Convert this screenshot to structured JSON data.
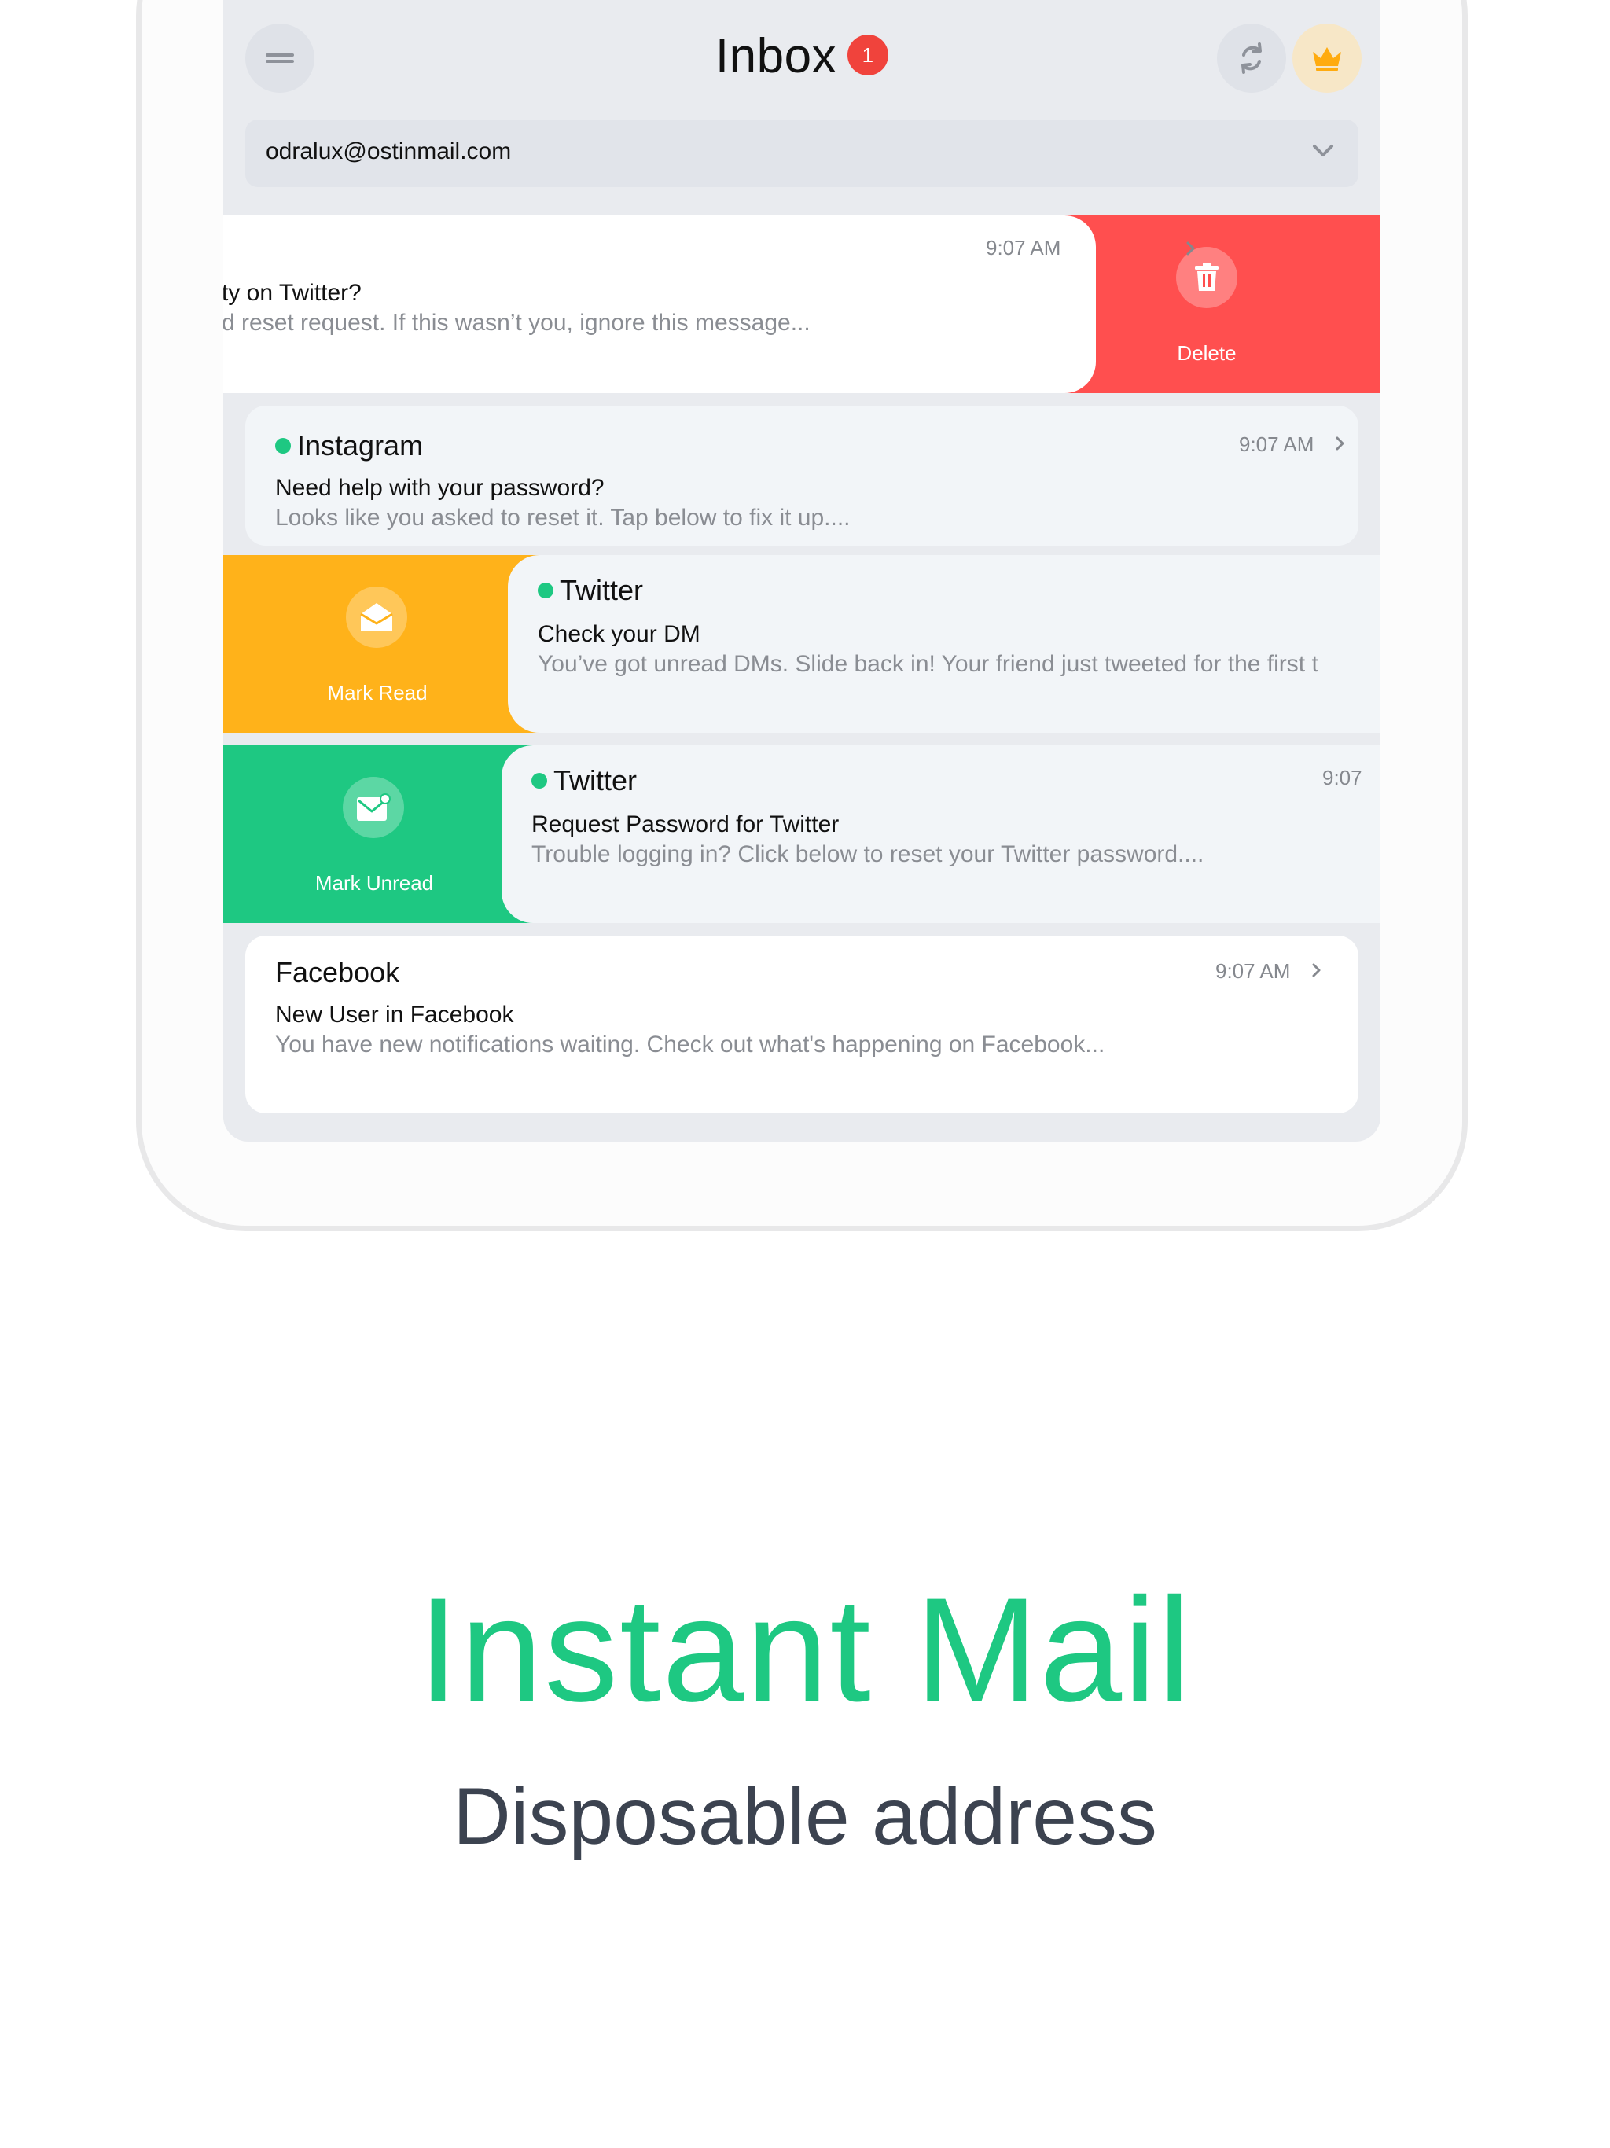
{
  "header": {
    "title": "Inbox",
    "badge_count": "1"
  },
  "account": {
    "email": "odralux@ostinmail.com"
  },
  "emails": [
    {
      "subject": "ty on Twitter?",
      "preview": "d reset request. If this wasn’t you, ignore this message...",
      "time": "9:07 AM",
      "action": "Delete"
    },
    {
      "sender": "Instagram",
      "subject": "Need help with your password?",
      "preview": "Looks like you asked to reset it. Tap below to fix it up....",
      "time": "9:07 AM"
    },
    {
      "sender": "Twitter",
      "subject": "Check your DM",
      "preview": "You’ve got unread DMs. Slide back in! Your friend just tweeted for the first t",
      "action": "Mark Read"
    },
    {
      "sender": "Twitter",
      "subject": "Request Password for Twitter",
      "preview": "Trouble logging in? Click below to reset your Twitter password....",
      "time": "9:07",
      "action": "Mark Unread"
    },
    {
      "sender": "Facebook",
      "subject": "New User in Facebook",
      "preview": "You have new notifications waiting. Check out what's happening on Facebook...",
      "time": "9:07 AM"
    }
  ],
  "hero": {
    "title": "Instant Mail",
    "subtitle": "Disposable address"
  },
  "colors": {
    "accent_green": "#1ec882",
    "delete_red": "#ff4f4f",
    "mark_read_yellow": "#ffb21a",
    "unread_dot": "#1ec882",
    "badge_red": "#f0433c"
  }
}
